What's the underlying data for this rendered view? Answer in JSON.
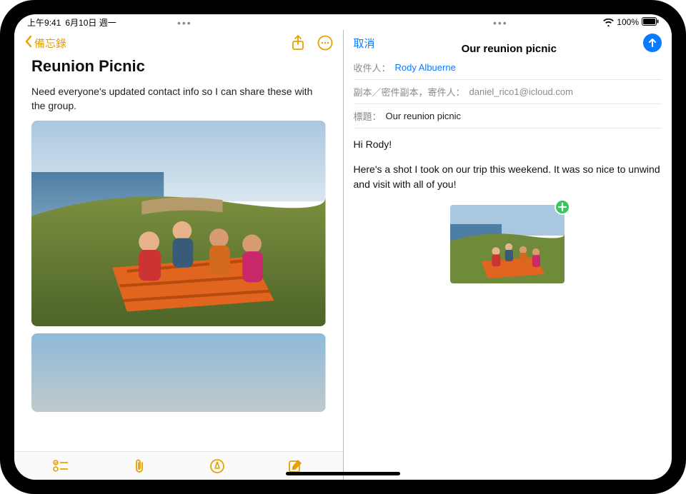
{
  "status": {
    "time": "上午9:41",
    "date": "6月10日 週一",
    "battery_pct": "100%"
  },
  "notes": {
    "back_label": "備忘錄",
    "title": "Reunion Picnic",
    "body_text": "Need everyone's updated contact info so I can share these with the group."
  },
  "mail": {
    "cancel": "取消",
    "subject_header": "Our reunion picnic",
    "to_label": "收件人：",
    "to_value": "Rody Albuerne",
    "ccbcc_label": "副本／密件副本，寄件人：",
    "from_value": "daniel_rico1@icloud.com",
    "subject_label": "標題：",
    "subject_value": "Our reunion picnic",
    "body_line1": "Hi Rody!",
    "body_line2": "Here's a shot I took on our trip this weekend. It was so nice to unwind and visit with all of you!"
  }
}
